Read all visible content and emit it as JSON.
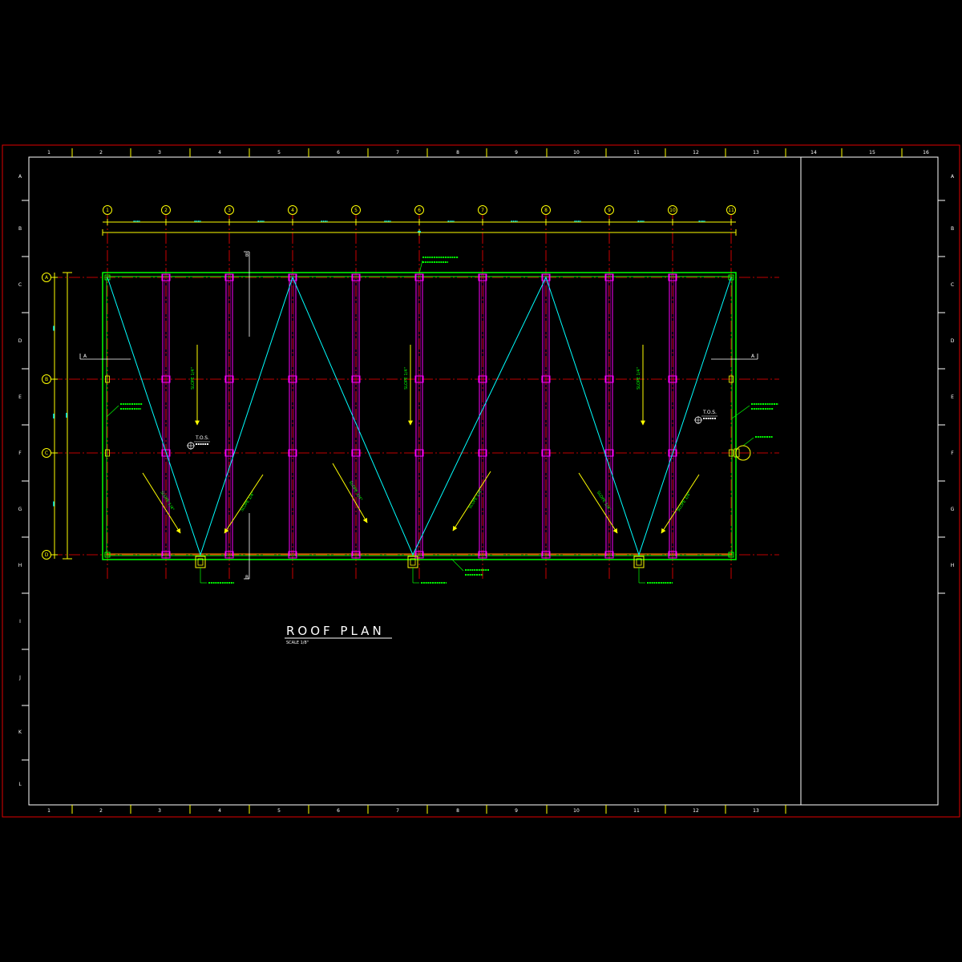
{
  "title": {
    "text": "ROOF PLAN",
    "scale": "SCALE 1/8\""
  },
  "border": {
    "top": [
      "1",
      "2",
      "3",
      "4",
      "5",
      "6",
      "7",
      "8",
      "9",
      "10",
      "11",
      "12",
      "13",
      "14",
      "15",
      "16"
    ],
    "bottom": [
      "1",
      "2",
      "3",
      "4",
      "5",
      "6",
      "7",
      "8",
      "9",
      "10",
      "11",
      "12",
      "13"
    ],
    "left": [
      "A",
      "B",
      "C",
      "D",
      "E",
      "F",
      "G",
      "H",
      "I",
      "J",
      "K",
      "L"
    ],
    "right": [
      "A",
      "B",
      "C",
      "D",
      "E",
      "F",
      "G",
      "H"
    ]
  },
  "grid": {
    "columns": [
      "1",
      "2",
      "3",
      "4",
      "5",
      "6",
      "7",
      "8",
      "9",
      "10",
      "11"
    ],
    "rows": [
      "A",
      "B",
      "C",
      "D"
    ]
  },
  "sections": {
    "a": "A",
    "b": "B"
  },
  "markers": {
    "tos": "T.O.S."
  },
  "notes": {
    "slope": "SLOPE 1/4\""
  },
  "colors": {
    "background": "#000000",
    "frame": "#e00000",
    "border": "#ffffff",
    "grid": "#ff0000",
    "bubble": "#ffff00",
    "dimension": "#ffff00",
    "dimension_text": "#00ffff",
    "outline": "#00ff00",
    "gutter": "#ff9900",
    "joist": "#ff00ff",
    "ridge": "#00ffff",
    "arrow": "#ffff00",
    "note": "#00ff00"
  }
}
